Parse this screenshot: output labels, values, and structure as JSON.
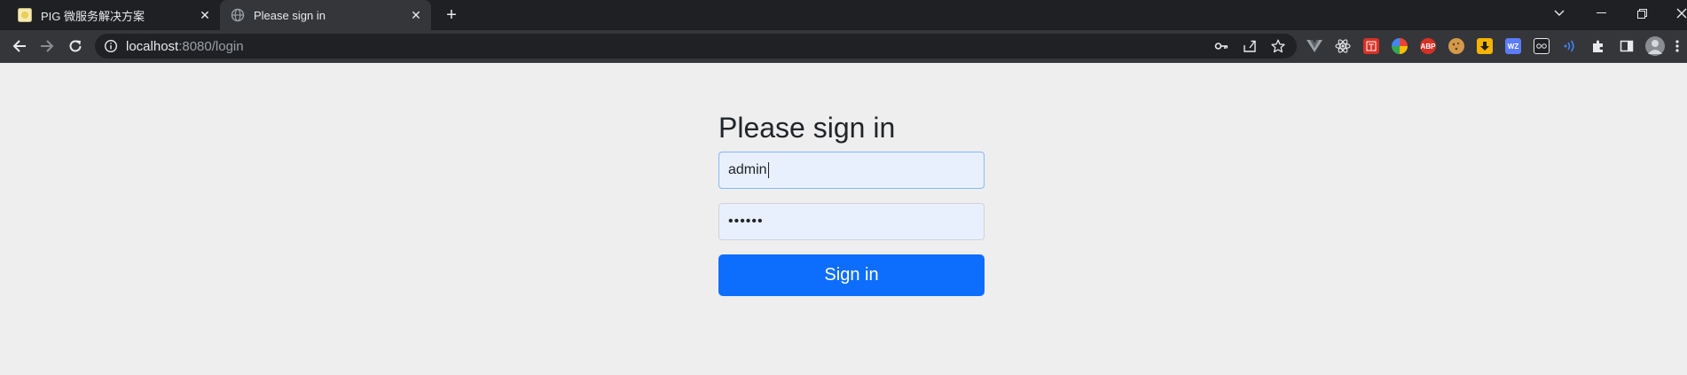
{
  "browser": {
    "tabs": [
      {
        "title": "PIG 微服务解决方案",
        "close": "✕",
        "favicon": "pig-favicon",
        "active": false
      },
      {
        "title": "Please sign in",
        "close": "✕",
        "favicon": "globe-icon",
        "active": true
      }
    ],
    "new_tab": "+",
    "window_controls": {
      "tab_search": "⌄",
      "minimize": "—",
      "restore": "❐",
      "close": "✕"
    },
    "address_bar": {
      "host": "localhost",
      "path": ":8080/login"
    },
    "extensions": [
      "vue-devtools",
      "react-devtools",
      "translate",
      "chrome-colorful",
      "abp",
      "cookie",
      "download",
      "wz",
      "cyborg",
      "wifi"
    ],
    "abp_label": "ABP",
    "wz_label": "WZ"
  },
  "login": {
    "heading": "Please sign in",
    "username_value": "admin",
    "password_value": "••••••",
    "submit_label": "Sign in"
  },
  "colors": {
    "tabstrip": "#1f2023",
    "toolbar": "#35363a",
    "page_bg": "#eeeeee",
    "autofill_bg": "#e8f0fe",
    "primary": "#0d6efd"
  }
}
